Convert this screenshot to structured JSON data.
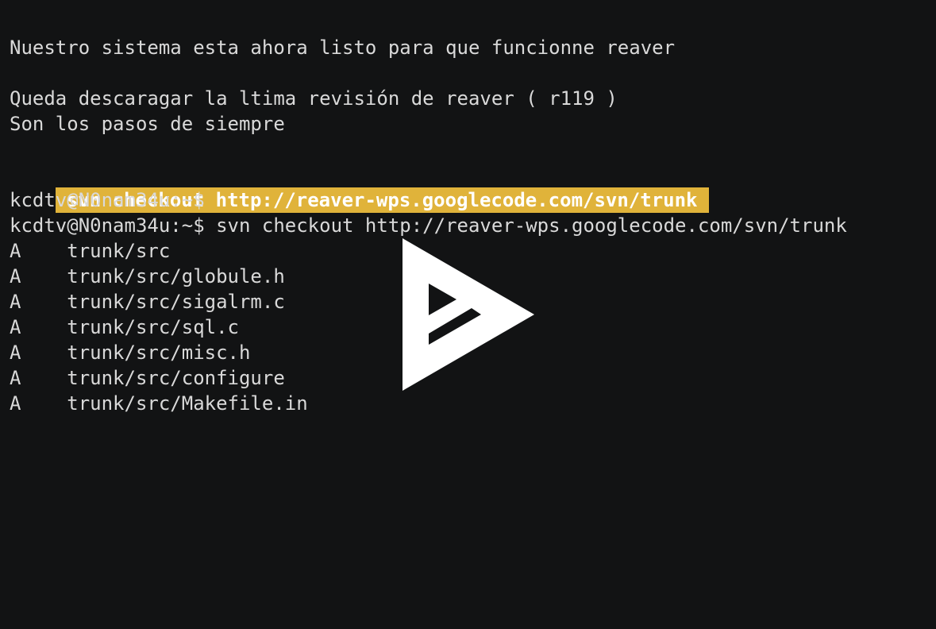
{
  "terminal": {
    "lines": [
      "",
      "Nuestro sistema esta ahora listo para que funcionne reaver",
      "",
      "Queda descaragar la ltima revisión de reaver ( r119 )",
      "Son los pasos de siempre",
      "",
      "svn checkout http://reaver-wps.googlecode.com/svn/trunk",
      "kcdtv@N0nam34u:~$",
      "kcdtv@N0nam34u:~$ svn checkout http://reaver-wps.googlecode.com/svn/trunk",
      "A    trunk/src",
      "A    trunk/src/globule.h",
      "A    trunk/src/sigalrm.c",
      "A    trunk/src/sql.c",
      "A    trunk/src/misc.h",
      "A    trunk/src/configure",
      "A    trunk/src/Makefile.in"
    ]
  },
  "colors": {
    "background": "#121314",
    "text": "#d9d9d9",
    "highlight_bg": "#e0b33a",
    "highlight_text": "#ffffff",
    "play_icon": "#ffffff"
  },
  "overlay": {
    "icon": "asciinema-play-icon"
  }
}
